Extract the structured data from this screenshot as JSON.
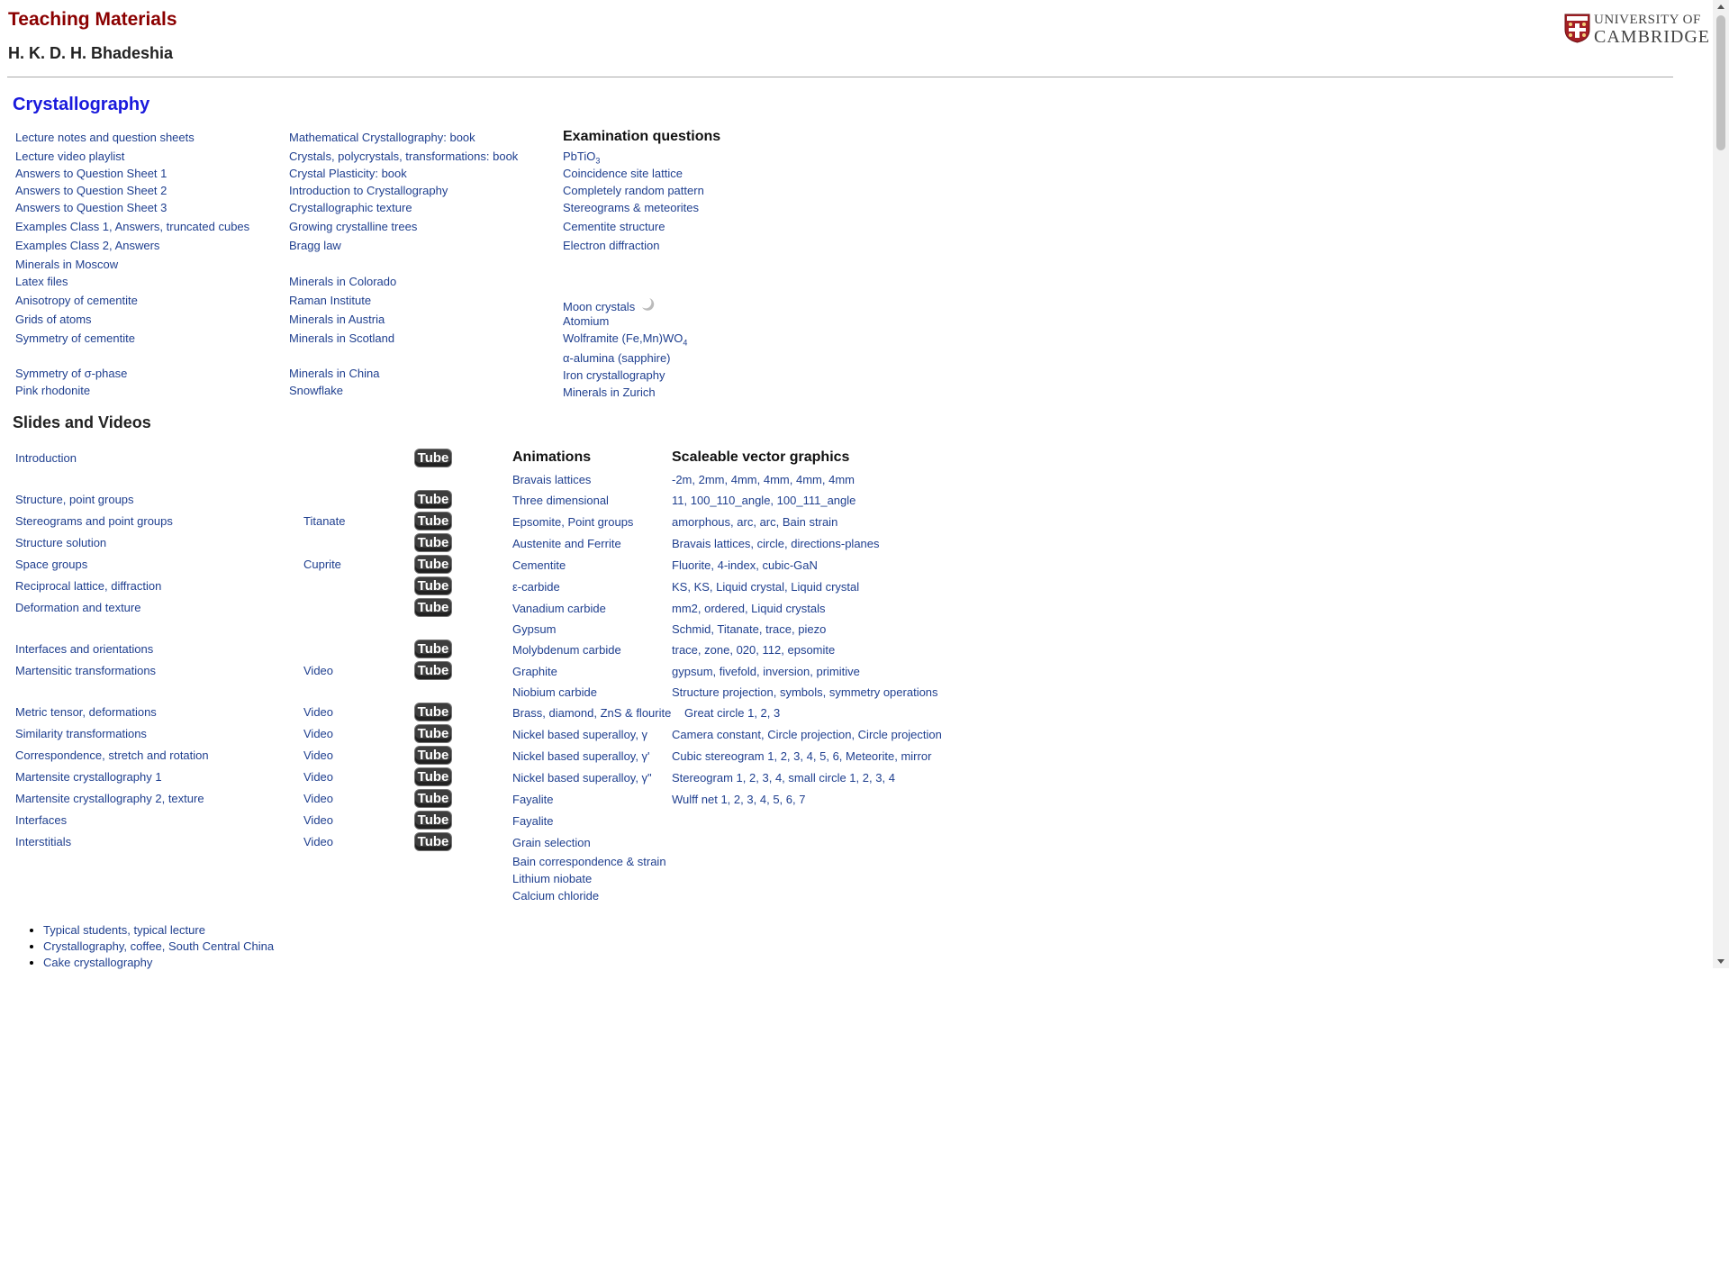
{
  "header": {
    "title": "Teaching Materials",
    "author": "H. K. D. H. Bhadeshia",
    "logo_line1": "UNIVERSITY OF",
    "logo_line2": "CAMBRIDGE"
  },
  "crystallography": {
    "heading": "Crystallography",
    "col1": [
      "Lecture notes and question sheets",
      "Lecture video playlist",
      "Answers to Question Sheet 1",
      "Answers to Question Sheet 2",
      "Answers to Question Sheet 3",
      [
        "Examples Class 1",
        "Answers",
        "truncated cubes"
      ],
      [
        "Examples Class 2",
        "Answers"
      ],
      "Minerals in Moscow",
      "Latex files",
      "Anisotropy of cementite",
      "Grids of atoms",
      "Symmetry of cementite",
      "Symmetry of σ-phase",
      "Pink rhodonite"
    ],
    "col2": [
      "Mathematical Crystallography: book",
      "Crystals, polycrystals, transformations: book",
      "Crystal Plasticity: book",
      "Introduction to Crystallography",
      "Crystallographic texture",
      "Growing crystalline trees",
      "Bragg law",
      "Minerals in Colorado",
      "Raman Institute",
      "Minerals in Austria",
      "Minerals in Scotland",
      "Minerals in China",
      "Snowflake"
    ],
    "exam_heading": "Examination questions",
    "col3": {
      "pbtio3": "PbTiO",
      "pbtio3_sub": "3",
      "items_a": [
        "Coincidence site lattice",
        "Completely random pattern",
        "Stereograms & meteorites",
        "Cementite structure",
        "Electron diffraction"
      ],
      "moon": "Moon crystals",
      "moon_icon": "crescent-moon-icon",
      "atomium": "Atomium",
      "wolframite": "Wolframite (Fe,Mn)WO",
      "wolframite_sub": "4",
      "items_b": [
        "α-alumina (sapphire)",
        "Iron crystallography",
        "Minerals in Zurich"
      ]
    }
  },
  "slides": {
    "heading": "Slides and Videos",
    "tube_label": "Tube",
    "lectures": [
      [
        "Introduction"
      ],
      [
        [
          "Structure",
          "point groups"
        ]
      ],
      [
        "Stereograms and point groups",
        "Titanate"
      ],
      [
        "Structure solution"
      ],
      [
        "Space groups",
        "Cuprite"
      ],
      [
        [
          "Reciprocal lattice",
          "diffraction"
        ]
      ],
      [
        "Deformation and texture"
      ],
      [
        "Interfaces and orientations"
      ],
      [
        "Martensitic transformations",
        "Video"
      ],
      [
        [
          "Metric tensor",
          "deformations"
        ],
        "Video"
      ],
      [
        "Similarity transformations",
        "Video"
      ],
      [
        "Correspondence, stretch and rotation",
        "Video"
      ],
      [
        "Martensite crystallography 1",
        "Video"
      ],
      [
        [
          "Martensite crystallography 2",
          "texture"
        ],
        "Video"
      ],
      [
        "Interfaces",
        "Video"
      ],
      [
        "Interstitials",
        "Video"
      ]
    ],
    "animations_heading": "Animations",
    "animations": [
      "Bravais lattices",
      "Three dimensional",
      [
        "Epsomite",
        "Point groups"
      ],
      "Austenite and Ferrite",
      "Cementite",
      "ε-carbide",
      "Vanadium carbide",
      "Gypsum",
      "Molybdenum carbide",
      "Graphite",
      "Niobium carbide",
      [
        "Brass",
        "diamond",
        "ZnS & flourite"
      ],
      "Nickel based superalloy, γ",
      "Nickel based superalloy, γ'",
      "Nickel based superalloy, γ\"",
      "Fayalite",
      "Fayalite",
      "Grain selection",
      "Bain correspondence & strain",
      "Lithium niobate",
      "Calcium chloride"
    ],
    "svg_heading": "Scaleable vector graphics",
    "svg": [
      [
        "-2m",
        "2mm",
        "4mm",
        "4mm",
        "4mm",
        "4mm"
      ],
      [
        "11",
        "100_110_angle",
        "100_111_angle"
      ],
      [
        "amorphous",
        "arc",
        "arc",
        "Bain strain"
      ],
      [
        "Bravais lattices",
        "circle",
        "directions-planes"
      ],
      [
        "Fluorite",
        "4-index",
        "cubic-GaN"
      ],
      [
        "KS",
        "KS",
        "Liquid crystal",
        "Liquid crystal"
      ],
      [
        "mm2",
        "ordered",
        "Liquid crystals"
      ],
      [
        "Schmid",
        "Titanate",
        "trace",
        "piezo"
      ],
      [
        "trace",
        "zone",
        "020",
        "112",
        "epsomite"
      ],
      [
        "gypsum",
        "fivefold",
        "inversion",
        "primitive"
      ],
      [
        "Structure projection",
        "symbols",
        "symmetry operations"
      ],
      [
        "Great circle 1",
        "2",
        "3"
      ],
      [
        "Camera constant",
        "Circle projection",
        "Circle projection"
      ],
      [
        "Cubic stereogram 1",
        "2",
        "3",
        "4",
        "5",
        "6",
        "Meteorite",
        "mirror"
      ],
      [
        "Stereogram 1",
        "2",
        "3",
        "4",
        "small circle 1",
        "2",
        "3",
        "4"
      ],
      [
        "Wulff net 1",
        "2",
        "3",
        "4",
        "5",
        "6",
        "7"
      ]
    ]
  },
  "misc": [
    [
      "Typical students",
      "typical lecture"
    ],
    [
      "Crystallography",
      "coffee",
      "South Central China"
    ],
    [
      "Cake crystallography"
    ]
  ]
}
